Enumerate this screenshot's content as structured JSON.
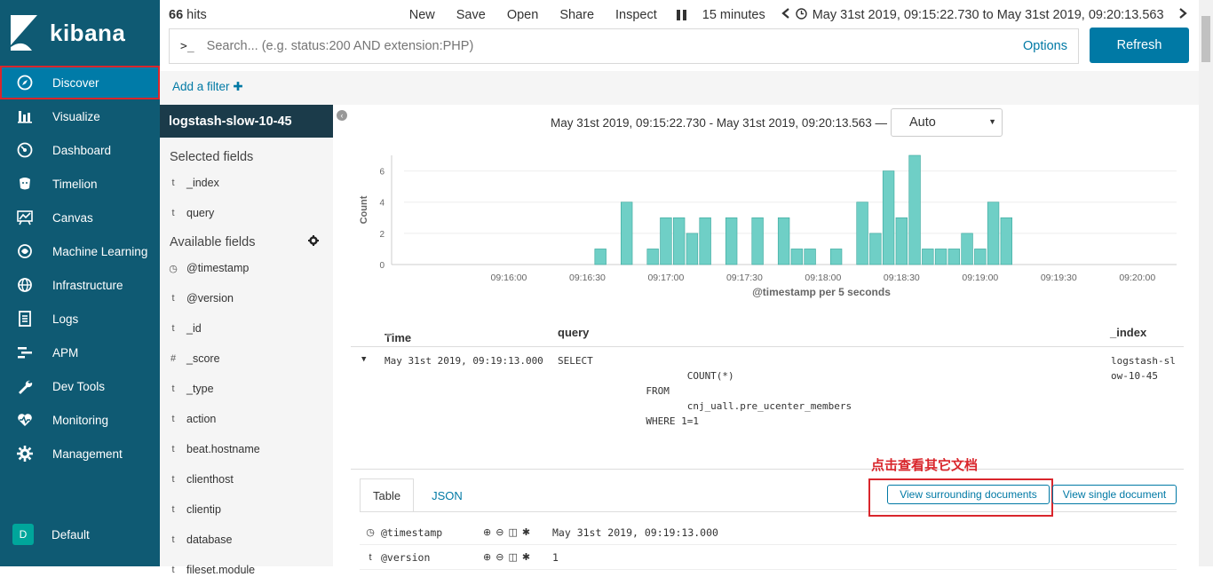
{
  "brand": {
    "name": "kibana"
  },
  "nav": {
    "items": [
      {
        "label": "Discover",
        "icon": "compass-icon"
      },
      {
        "label": "Visualize",
        "icon": "bar-chart-icon"
      },
      {
        "label": "Dashboard",
        "icon": "dashboard-icon"
      },
      {
        "label": "Timelion",
        "icon": "timelion-icon"
      },
      {
        "label": "Canvas",
        "icon": "canvas-icon"
      },
      {
        "label": "Machine Learning",
        "icon": "ml-icon"
      },
      {
        "label": "Infrastructure",
        "icon": "infrastructure-icon"
      },
      {
        "label": "Logs",
        "icon": "logs-icon"
      },
      {
        "label": "APM",
        "icon": "apm-icon"
      },
      {
        "label": "Dev Tools",
        "icon": "wrench-icon"
      },
      {
        "label": "Monitoring",
        "icon": "heartbeat-icon"
      },
      {
        "label": "Management",
        "icon": "gear-icon"
      }
    ],
    "space_badge": "D",
    "space_label": "Default"
  },
  "topbar": {
    "hits_count": "66",
    "hits_label": "hits",
    "menu": [
      "New",
      "Save",
      "Open",
      "Share",
      "Inspect"
    ],
    "refresh_interval": "15 minutes",
    "time_range": "May 31st 2019, 09:15:22.730 to May 31st 2019, 09:20:13.563"
  },
  "search": {
    "prompt": ">_",
    "placeholder": "Search... (e.g. status:200 AND extension:PHP)",
    "options_label": "Options",
    "refresh_label": "Refresh"
  },
  "filter": {
    "add_label": "Add a filter"
  },
  "sidebar": {
    "index_pattern": "logstash-slow-10-45",
    "selected_title": "Selected fields",
    "selected_fields": [
      {
        "type": "t",
        "name": "_index"
      },
      {
        "type": "t",
        "name": "query"
      }
    ],
    "available_title": "Available fields",
    "available_fields": [
      {
        "type": "◷",
        "name": "@timestamp"
      },
      {
        "type": "t",
        "name": "@version"
      },
      {
        "type": "t",
        "name": "_id"
      },
      {
        "type": "#",
        "name": "_score"
      },
      {
        "type": "t",
        "name": "_type"
      },
      {
        "type": "t",
        "name": "action"
      },
      {
        "type": "t",
        "name": "beat.hostname"
      },
      {
        "type": "t",
        "name": "clienthost"
      },
      {
        "type": "t",
        "name": "clientip"
      },
      {
        "type": "t",
        "name": "database"
      },
      {
        "type": "t",
        "name": "fileset.module"
      }
    ]
  },
  "histogram": {
    "range_label": "May 31st 2019, 09:15:22.730 - May 31st 2019, 09:20:13.563 —",
    "interval": "Auto"
  },
  "chart_data": {
    "type": "bar",
    "xlabel": "@timestamp per 5 seconds",
    "ylabel": "Count",
    "ylim": [
      0,
      7
    ],
    "yticks": [
      0,
      2,
      4,
      6
    ],
    "x_start": "09:15:20",
    "x_end": "09:20:15",
    "xticks": [
      "09:16:00",
      "09:16:30",
      "09:17:00",
      "09:17:30",
      "09:18:00",
      "09:18:30",
      "09:19:00",
      "09:19:30",
      "09:20:00"
    ],
    "x": [
      "09:16:35",
      "09:16:40",
      "09:16:45",
      "09:16:50",
      "09:16:55",
      "09:17:00",
      "09:17:05",
      "09:17:10",
      "09:17:15",
      "09:17:20",
      "09:17:25",
      "09:17:30",
      "09:17:35",
      "09:17:40",
      "09:17:45",
      "09:17:50",
      "09:17:55",
      "09:18:00",
      "09:18:05",
      "09:18:10",
      "09:18:15",
      "09:18:20",
      "09:18:25",
      "09:18:30",
      "09:18:35",
      "09:18:40",
      "09:18:45",
      "09:18:50",
      "09:18:55",
      "09:19:00",
      "09:19:05",
      "09:19:10"
    ],
    "values": [
      1,
      0,
      4,
      0,
      1,
      3,
      3,
      2,
      3,
      0,
      3,
      0,
      3,
      0,
      3,
      1,
      1,
      0,
      1,
      0,
      4,
      2,
      6,
      3,
      7,
      1,
      1,
      1,
      2,
      1,
      4,
      3,
      2
    ],
    "grid": true,
    "color": "#6fcfc6"
  },
  "doc_table": {
    "columns": [
      "Time",
      "query",
      "_index"
    ],
    "row": {
      "time": "May 31st 2019, 09:19:13.000",
      "query": "SELECT\n                      COUNT(*)\n               FROM\n                      cnj_uall.pre_ucenter_members\n               WHERE 1=1",
      "index": "logstash-sl\now-10-45"
    }
  },
  "detail": {
    "tabs": [
      "Table",
      "JSON"
    ],
    "annotation": "点击查看其它文档",
    "surrounding_label": "View surrounding documents",
    "single_label": "View single document",
    "fields": [
      {
        "type": "◷",
        "name": "@timestamp",
        "value": "May 31st 2019, 09:19:13.000"
      },
      {
        "type": "t",
        "name": "@version",
        "value": "1"
      }
    ]
  }
}
